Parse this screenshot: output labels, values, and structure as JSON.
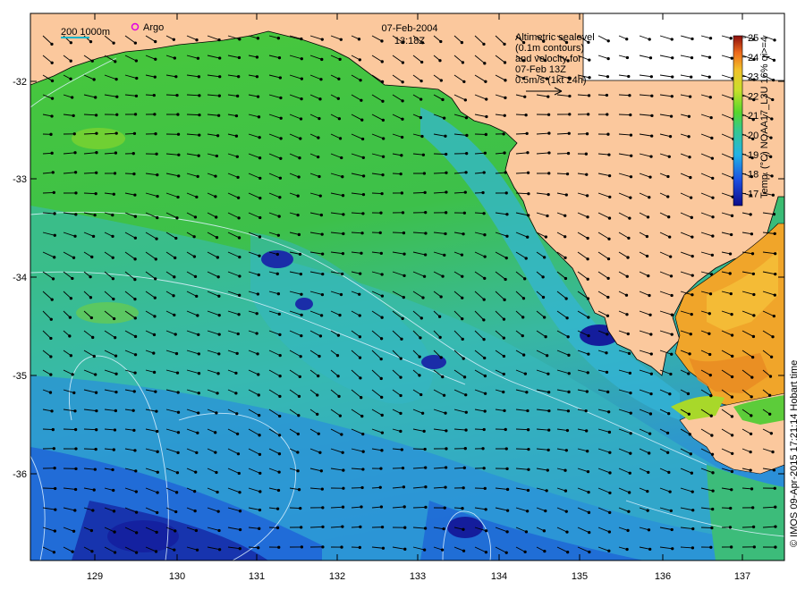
{
  "map": {
    "date": "07-Feb-2004",
    "time": "13:18Z",
    "scale_label": "200  1000m",
    "argo_label": "Argo",
    "legend_lines": [
      "Altimetric sealevel",
      "(0.1m contours)",
      "and velocity for",
      "07-Feb 13Z",
      "0.5m/s (1kt 24h)"
    ],
    "credit": "© IMOS 09-Apr-2015 17:21:14 Hobart time",
    "colorbar_title": "Temp. (°C) NOAA17_L3U 16% qi>=4",
    "colorbar_ticks": [
      "25",
      "24",
      "23",
      "22",
      "21",
      "20",
      "19",
      "18",
      "17"
    ],
    "lon_ticks": [
      "129",
      "130",
      "131",
      "132",
      "133",
      "134",
      "135",
      "136",
      "137"
    ],
    "lat_ticks": [
      "-32",
      "-33",
      "-34",
      "-35",
      "-36"
    ],
    "colors": {
      "land": "#fbc89d",
      "ocean_green": "#3cc23a",
      "ocean_cyan": "#36b7c8",
      "ocean_blue": "#1f67dd",
      "ocean_deep": "#121a9a",
      "warm": "#f0a52a"
    }
  }
}
